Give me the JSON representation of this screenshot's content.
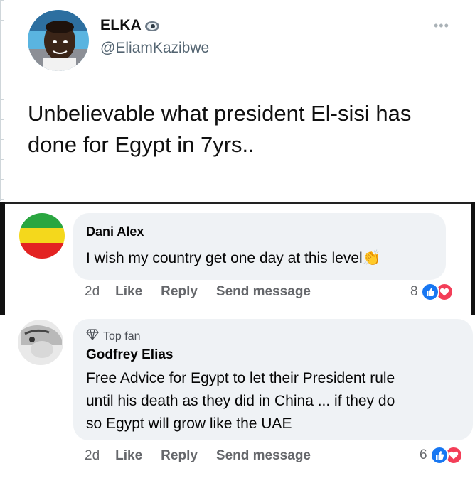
{
  "tweet": {
    "display_name": "ELKA",
    "handle": "@EliamKazibwe",
    "more_label": "•••",
    "text": "Unbelievable what president El-sisi has done for Egypt in 7yrs.."
  },
  "comments": [
    {
      "author": "Dani Alex",
      "text": "I wish my country get one day at this level",
      "emoji": "👏",
      "time": "2d",
      "like_label": "Like",
      "reply_label": "Reply",
      "send_label": "Send message",
      "reaction_count": "8"
    },
    {
      "badge": "Top fan",
      "author": "Godfrey Elias",
      "text_lines": [
        "Free Advice for Egypt to let their President rule",
        "until his death as they did in China ... if they do",
        "so Egypt will grow like the UAE"
      ],
      "time": "2d",
      "like_label": "Like",
      "reply_label": "Reply",
      "send_label": "Send message",
      "reaction_count": "6"
    }
  ],
  "colors": {
    "bubble": "#eff2f5",
    "action_text": "#65676b",
    "like_blue": "#1877f2",
    "love_red": "#f33e58",
    "handle_gray": "#536471"
  }
}
